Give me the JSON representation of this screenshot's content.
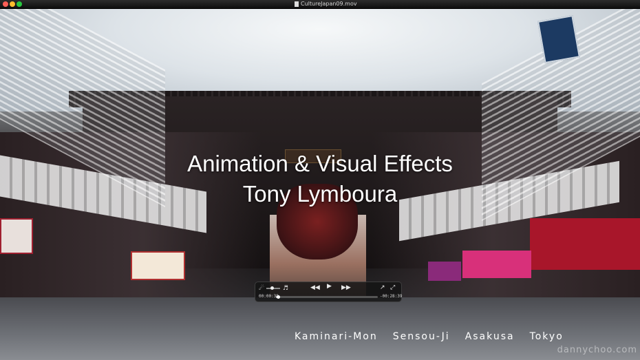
{
  "window": {
    "title": "CultureJapan09.mov"
  },
  "video": {
    "overlay_title": "Animation & Visual Effects",
    "overlay_subtitle": "Tony Lymboura",
    "locations": [
      "Kaminari-Mon",
      "Sensou-Ji",
      "Asakusa",
      "Tokyo"
    ],
    "watermark": "dannychoo.com"
  },
  "controls": {
    "elapsed": "00:00:38",
    "remaining": "-00:28:39",
    "playback_progress": 0.022,
    "volume_level": 0.4,
    "icons": {
      "volume_low": "speaker-low-icon",
      "volume_high": "speaker-high-icon",
      "rewind": "rewind-icon",
      "play": "play-icon",
      "fast_forward": "fast-forward-icon",
      "share": "share-icon",
      "fullscreen": "fullscreen-icon"
    }
  },
  "colors": {
    "titlebar": "#1a1a1a",
    "overlay_text": "#ffffff",
    "hud_background": "#141414"
  }
}
